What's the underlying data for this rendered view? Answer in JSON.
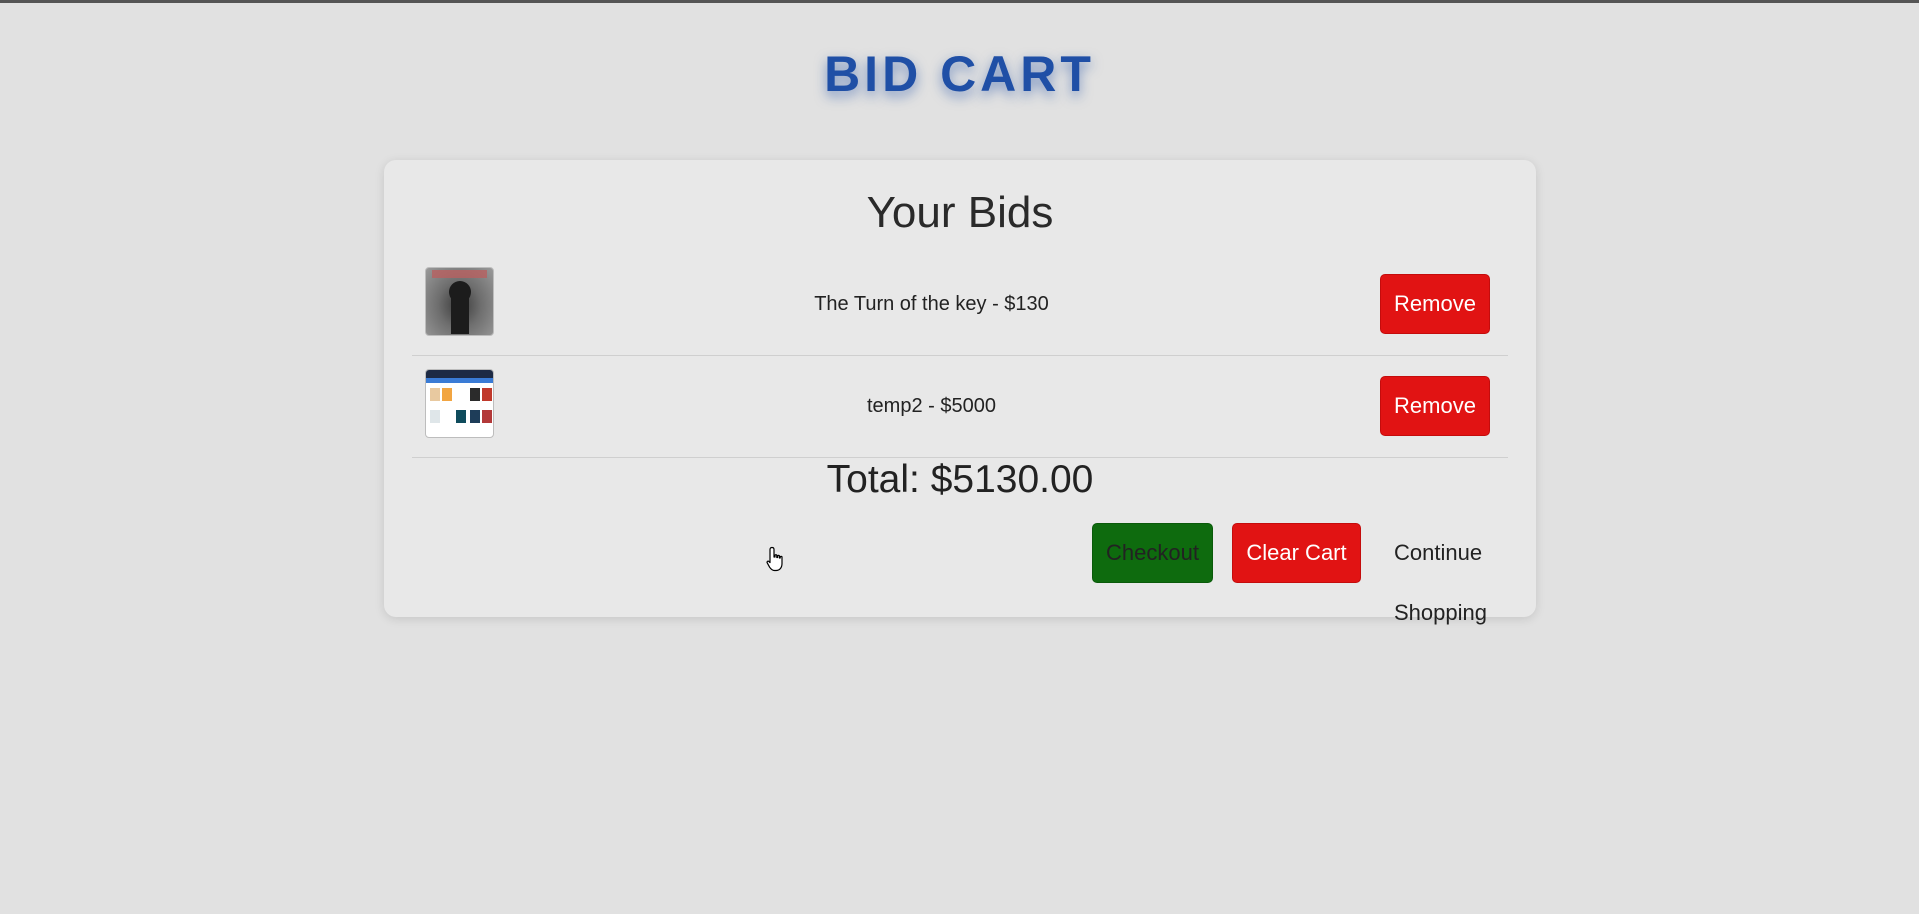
{
  "header": {
    "title": "BID CART"
  },
  "cart": {
    "heading": "Your Bids",
    "items": [
      {
        "label": "The Turn of the key - $130",
        "remove_label": "Remove"
      },
      {
        "label": "temp2 - $5000",
        "remove_label": "Remove"
      }
    ],
    "total": "Total: $5130.00"
  },
  "actions": {
    "checkout_label": "Checkout",
    "clear_label": "Clear Cart",
    "continue_label": "Continue Shopping"
  },
  "colors": {
    "title": "#1f4fa6",
    "remove": "#e11313",
    "checkout": "#0e6b0e",
    "background": "#e1e1e1"
  },
  "icons": {
    "cursor": "hand-pointer-icon"
  }
}
